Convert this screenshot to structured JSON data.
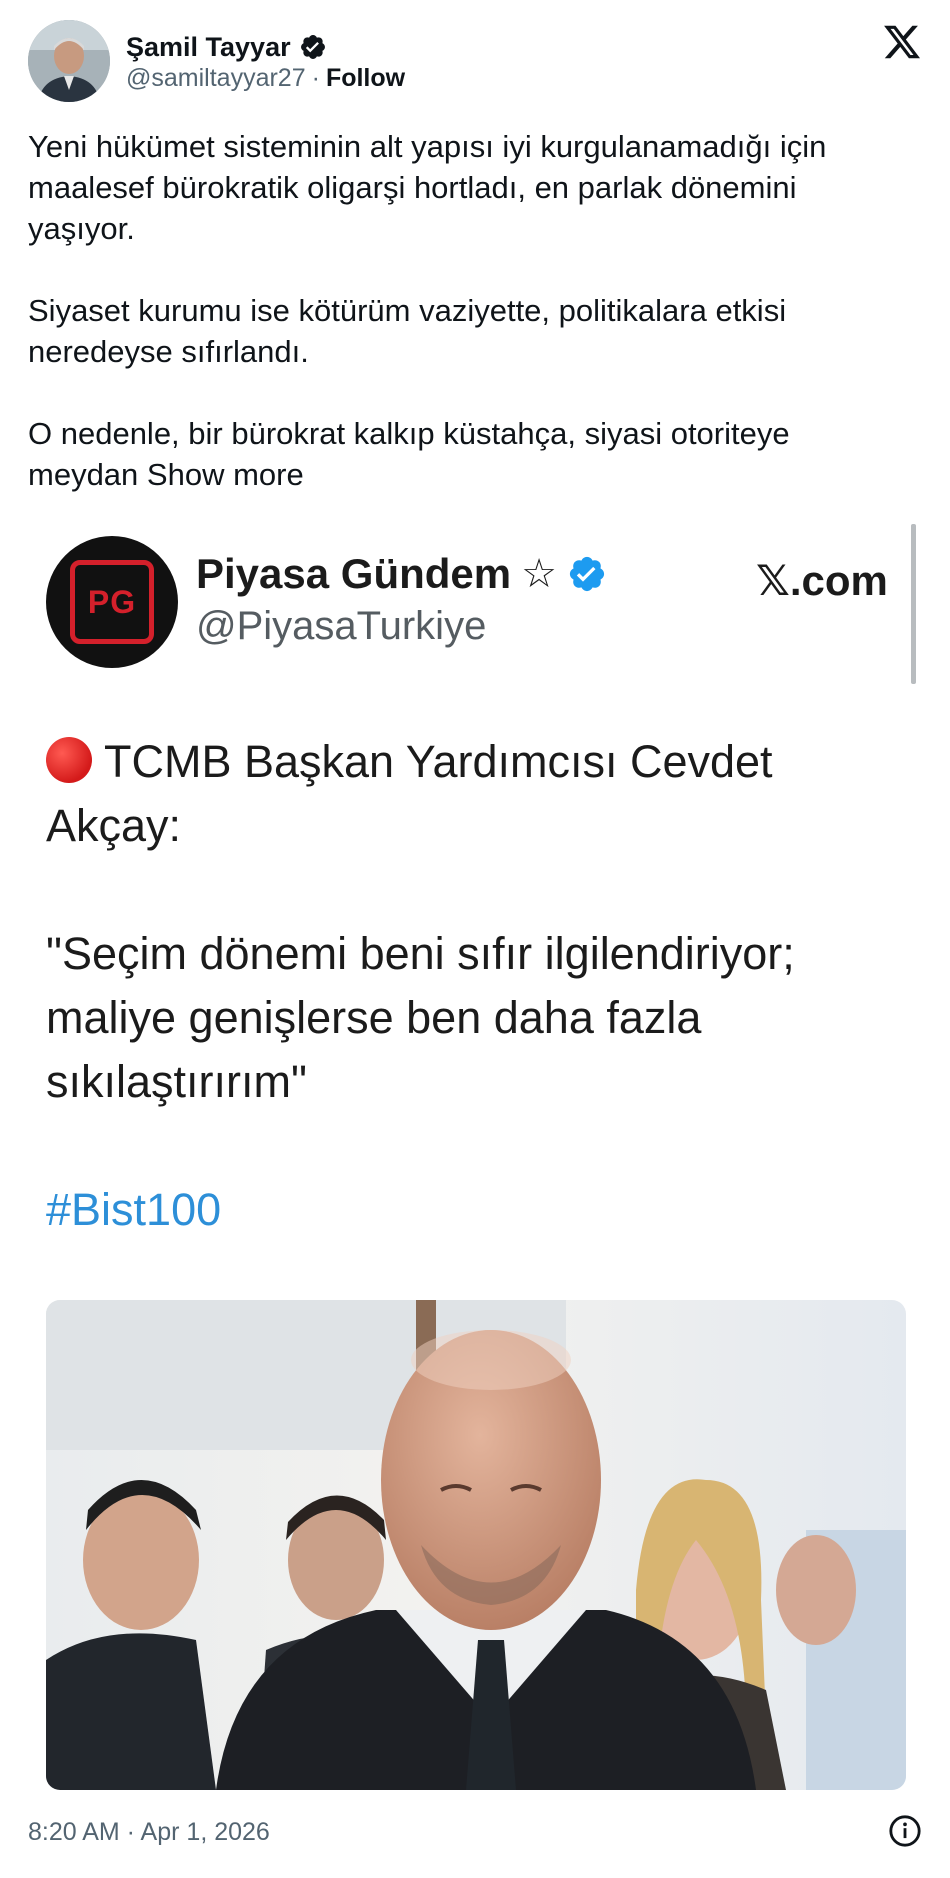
{
  "author": {
    "name": "Şamil Tayyar",
    "handle": "@samiltayyar27",
    "separator": "·",
    "follow_label": "Follow"
  },
  "tweet": {
    "paragraphs": [
      "Yeni hükümet sisteminin alt yapısı iyi kurgulanamadığı için maalesef bürokratik oligarşi hortladı, en parlak dönemini yaşıyor.",
      "Siyaset kurumu ise kötürüm vaziyette, politikalara etkisi neredeyse sıfırlandı."
    ],
    "last_paragraph": "O nedenle, bir bürokrat kalkıp küstahça, siyasi otoriteye meydan",
    "show_more": "Show more"
  },
  "embedded": {
    "logo_text": "PG",
    "name": "Piyasa Gündem",
    "star": "☆",
    "handle": "@PiyasaTurkiye",
    "site": "𝕏.com",
    "headline": "TCMB Başkan Yardımcısı Cevdet Akçay:",
    "quote": "\"Seçim dönemi beni sıfır ilgilendiriyor; maliye genişlerse ben daha fazla sıkılaştırırım\"",
    "hashtag": "#Bist100"
  },
  "footer": {
    "timestamp": "8:20 AM · Apr 1, 2026"
  },
  "colors": {
    "text": "#0f1419",
    "secondary": "#536471",
    "verified_blue": "#1d9bf0",
    "hashtag": "#2d8fd8",
    "pg_red": "#d4202b"
  },
  "icons": [
    "verified-badge-icon",
    "x-logo-icon",
    "info-icon",
    "red-circle-icon"
  ]
}
